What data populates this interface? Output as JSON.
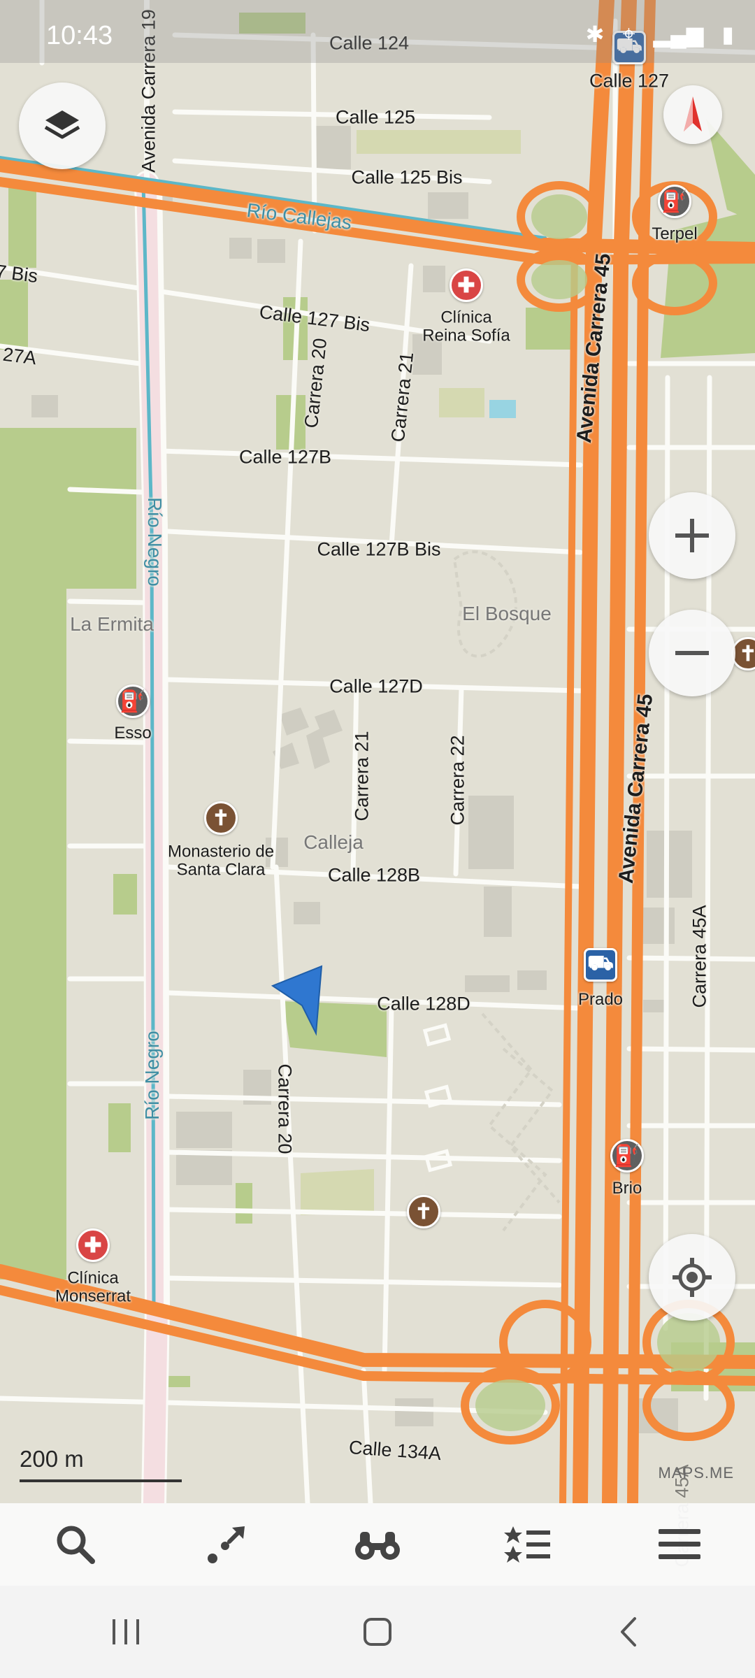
{
  "status_bar": {
    "time": "10:43",
    "icons": [
      "whatsapp-icon",
      "messages-icon",
      "bluetooth-icon",
      "location-icon",
      "signal-icon",
      "battery-icon"
    ]
  },
  "map": {
    "streets": {
      "calle_124": "Calle 124",
      "calle_125": "Calle 125",
      "calle_125_bis": "Calle 125 Bis",
      "calle_127": "Calle 127",
      "calle_127_bis": "Calle 127 Bis",
      "calle_127b": "Calle 127B",
      "calle_127b_bis": "Calle 127B Bis",
      "calle_127d": "Calle 127D",
      "calle_128b": "Calle 128B",
      "calle_128d": "Calle 128D",
      "calle_134a": "Calle 134A",
      "avenida_carrera_19": "Avenida Carrera 19",
      "avenida_carrera_45_top": "Avenida Carrera 45",
      "avenida_carrera_45_mid": "Avenida Carrera 45",
      "carrera_20_top": "Carrera 20",
      "carrera_20_bottom": "Carrera 20",
      "carrera_21_top": "Carrera 21",
      "carrera_21_mid": "Carrera 21",
      "carrera_22": "Carrera 22",
      "carrera_45a": "Carrera 45A",
      "carrera_45a_bottom": "Carrera 45A",
      "edge_7_bis": "7 Bis",
      "edge_27a": "27A"
    },
    "rivers": {
      "rio_callejas": "Río Callejas",
      "rio_negro_top": "Río Negro",
      "rio_negro_bottom": "Río Negro"
    },
    "areas": {
      "la_ermita": "La Ermita",
      "el_bosque": "El Bosque",
      "calleja": "Calleja"
    },
    "pois": {
      "terpel": "Terpel",
      "clinica_reina_sofia": "Clínica\nReina Sofía",
      "esso": "Esso",
      "monasterio": "Monasterio de\nSanta Clara",
      "prado": "Prado",
      "brio": "Brio",
      "clinica_monserrat": "Clínica\nMonserrat"
    },
    "scale_label": "200 m",
    "attribution": "MAPS.ME"
  },
  "controls": {
    "layers": "layers-icon",
    "compass": "compass-icon",
    "zoom_in": "plus-icon",
    "zoom_out": "minus-icon",
    "my_location": "my-location-icon"
  },
  "toolbar": [
    "search-icon",
    "route-icon",
    "discovery-icon",
    "bookmarks-icon",
    "menu-icon"
  ],
  "nav_bar": [
    "recent-apps-icon",
    "home-icon",
    "back-icon"
  ],
  "colors": {
    "land": "#e2e0d4",
    "park": "#b7cc8c",
    "highway": "#f48a3c",
    "river": "#5cb7c8",
    "hospital": "#d94545",
    "church": "#7a5234",
    "fuel": "#5f5f5f",
    "bus": "#2b62a6",
    "position_arrow": "#2f77d0"
  }
}
